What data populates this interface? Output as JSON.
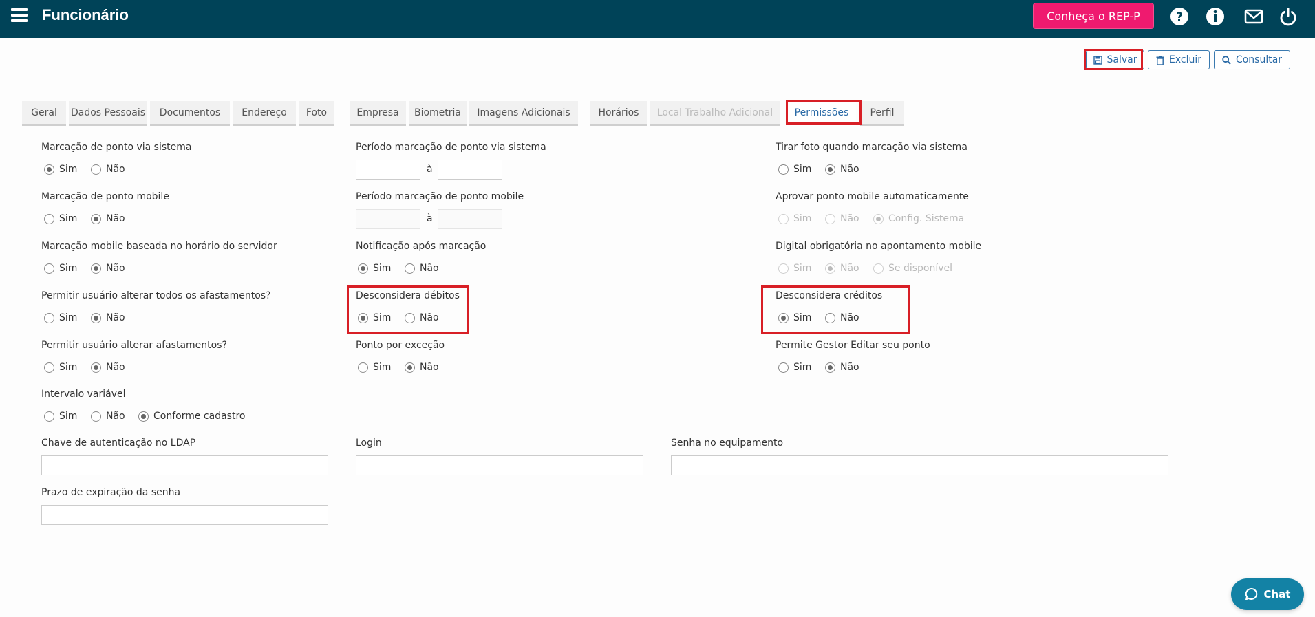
{
  "header": {
    "title": "Funcionário",
    "rep_button": "Conheça o REP-P",
    "icons": [
      "menu-icon",
      "help-icon",
      "info-icon",
      "mail-icon",
      "power-icon"
    ],
    "bar_color": "#004358",
    "accent_color": "#ef1a6f"
  },
  "actions": {
    "save": "Salvar",
    "delete": "Excluir",
    "search": "Consultar"
  },
  "tabs": [
    {
      "label": "Geral"
    },
    {
      "label": "Dados Pessoais"
    },
    {
      "label": "Documentos"
    },
    {
      "label": "Endereço"
    },
    {
      "label": "Foto"
    },
    {
      "label": "Empresa"
    },
    {
      "label": "Biometria"
    },
    {
      "label": "Imagens Adicionais"
    },
    {
      "label": "Horários"
    },
    {
      "label": "Local Trabalho Adicional",
      "disabled": true
    },
    {
      "label": "Permissões",
      "active": true
    },
    {
      "label": "Perfil"
    }
  ],
  "fields": {
    "marcacao_sistema": {
      "label": "Marcação de ponto via sistema",
      "options": [
        "Sim",
        "Não"
      ],
      "selected": "Sim"
    },
    "marcacao_mobile": {
      "label": "Marcação de ponto mobile",
      "options": [
        "Sim",
        "Não"
      ],
      "selected": "Não"
    },
    "mobile_horario_servidor": {
      "label": "Marcação mobile baseada no horário do servidor",
      "options": [
        "Sim",
        "Não"
      ],
      "selected": "Não"
    },
    "alterar_todos_afastamentos": {
      "label": "Permitir usuário alterar todos os afastamentos?",
      "options": [
        "Sim",
        "Não"
      ],
      "selected": "Não"
    },
    "alterar_afastamentos": {
      "label": "Permitir usuário alterar afastamentos?",
      "options": [
        "Sim",
        "Não"
      ],
      "selected": "Não"
    },
    "intervalo_variavel": {
      "label": "Intervalo variável",
      "options": [
        "Sim",
        "Não",
        "Conforme cadastro"
      ],
      "selected": "Conforme cadastro"
    },
    "periodo_sistema": {
      "label": "Período marcação de ponto via sistema",
      "separator": "à",
      "from": "",
      "to": ""
    },
    "periodo_mobile": {
      "label": "Período marcação de ponto mobile",
      "separator": "à",
      "from": "",
      "to": ""
    },
    "notificacao": {
      "label": "Notificação após marcação",
      "options": [
        "Sim",
        "Não"
      ],
      "selected": "Sim"
    },
    "desconsidera_debitos": {
      "label": "Desconsidera débitos",
      "options": [
        "Sim",
        "Não"
      ],
      "selected": "Sim"
    },
    "ponto_excecao": {
      "label": "Ponto por exceção",
      "options": [
        "Sim",
        "Não"
      ],
      "selected": "Não"
    },
    "tirar_foto": {
      "label": "Tirar foto quando marcação via sistema",
      "options": [
        "Sim",
        "Não"
      ],
      "selected": "Não"
    },
    "aprovar_mobile": {
      "label": "Aprovar ponto mobile automaticamente",
      "options": [
        "Sim",
        "Não",
        "Config. Sistema"
      ],
      "selected": "Config. Sistema",
      "disabled": true
    },
    "digital_obrigatoria": {
      "label": "Digital obrigatória no apontamento mobile",
      "options": [
        "Sim",
        "Não",
        "Se disponível"
      ],
      "selected": "Não",
      "disabled": true
    },
    "desconsidera_creditos": {
      "label": "Desconsidera créditos",
      "options": [
        "Sim",
        "Não"
      ],
      "selected": "Sim"
    },
    "gestor_editar": {
      "label": "Permite Gestor Editar seu ponto",
      "options": [
        "Sim",
        "Não"
      ],
      "selected": "Não"
    },
    "chave_ldap": {
      "label": "Chave de autenticação no LDAP",
      "value": ""
    },
    "login": {
      "label": "Login",
      "value": ""
    },
    "senha_equipamento": {
      "label": "Senha no equipamento",
      "value": ""
    },
    "prazo_expiracao": {
      "label": "Prazo de expiração da senha",
      "value": ""
    }
  },
  "chat": {
    "label": "Chat",
    "color": "#1382a5"
  },
  "highlight_color": "#d81f26"
}
